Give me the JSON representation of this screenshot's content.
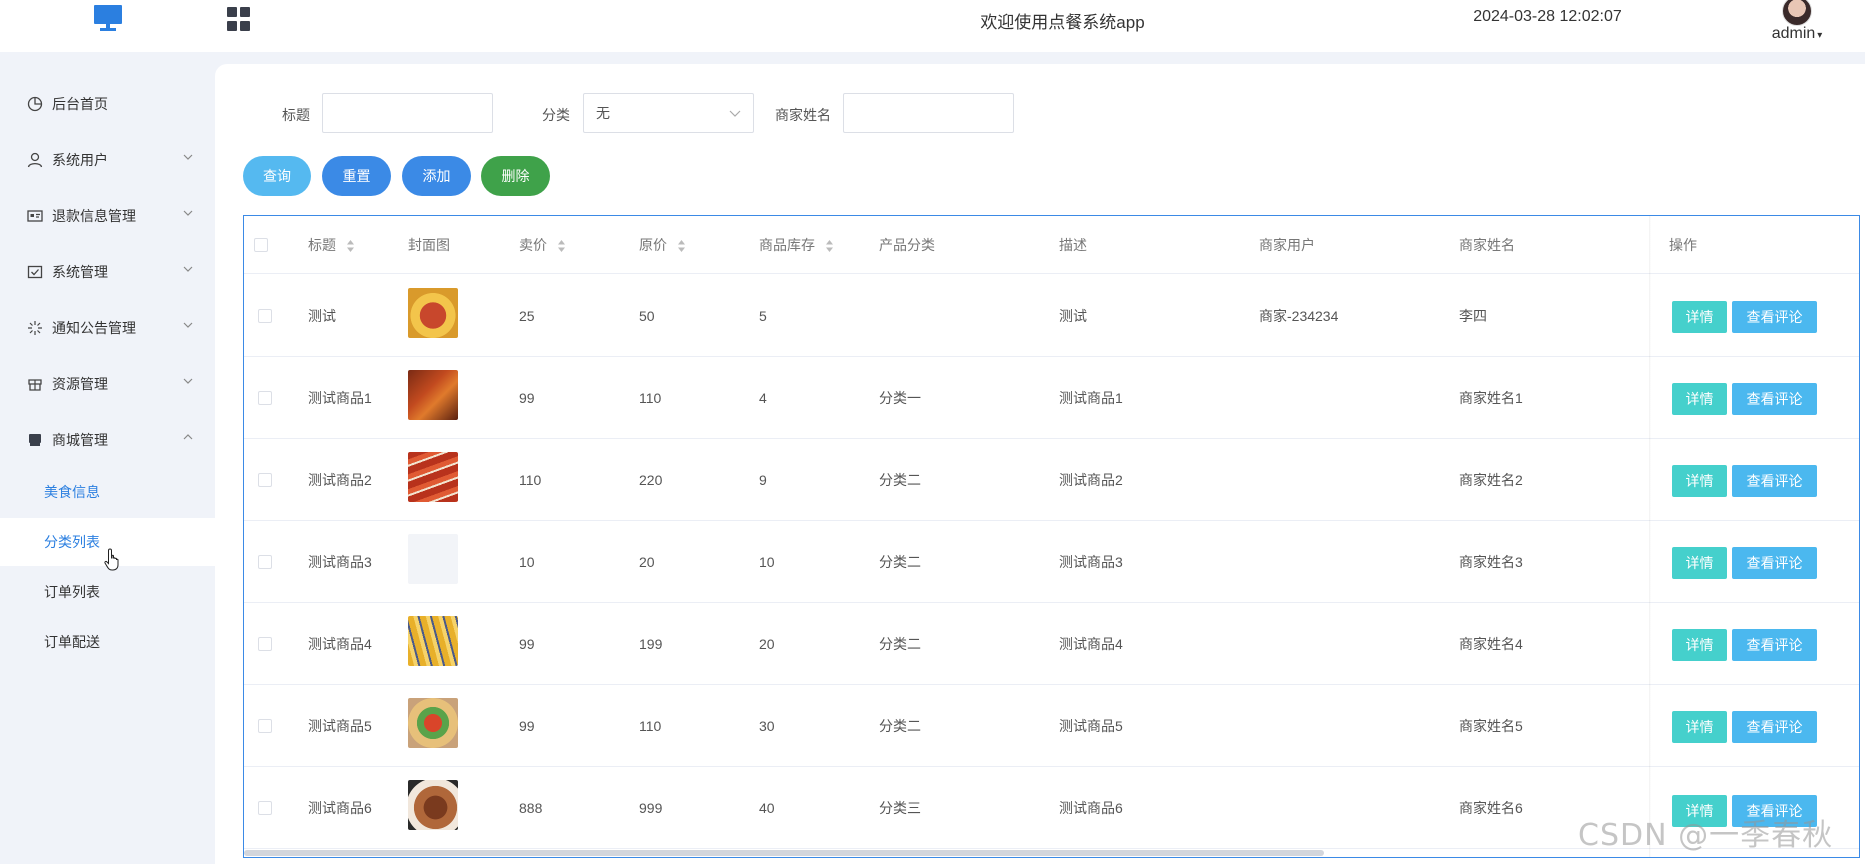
{
  "header": {
    "app_title": "欢迎使用点餐系统app",
    "datetime": "2024-03-28 12:02:07",
    "username": "admin"
  },
  "sidebar": {
    "items": [
      {
        "label": "后台首页",
        "icon": "dashboard-icon",
        "expandable": false
      },
      {
        "label": "系统用户",
        "icon": "user-icon",
        "expandable": true
      },
      {
        "label": "退款信息管理",
        "icon": "id-card-icon",
        "expandable": true
      },
      {
        "label": "系统管理",
        "icon": "checkbox-icon",
        "expandable": true
      },
      {
        "label": "通知公告管理",
        "icon": "sparkle-icon",
        "expandable": true
      },
      {
        "label": "资源管理",
        "icon": "tag-icon",
        "expandable": true
      },
      {
        "label": "商城管理",
        "icon": "shop-icon",
        "expandable": true,
        "expanded": true
      }
    ],
    "submenu": [
      {
        "label": "美食信息",
        "active": false,
        "highlight": true
      },
      {
        "label": "分类列表",
        "active": true
      },
      {
        "label": "订单列表",
        "active": false
      },
      {
        "label": "订单配送",
        "active": false
      }
    ]
  },
  "filters": {
    "title_label": "标题",
    "title_value": "",
    "category_label": "分类",
    "category_value": "无",
    "merchant_label": "商家姓名",
    "merchant_value": ""
  },
  "buttons": {
    "query": "查询",
    "reset": "重置",
    "add": "添加",
    "delete": "删除"
  },
  "table": {
    "headers": {
      "title": "标题",
      "cover": "封面图",
      "price": "卖价",
      "orig_price": "原价",
      "stock": "商品库存",
      "category": "产品分类",
      "desc": "描述",
      "merchant_user": "商家用户",
      "merchant_name": "商家姓名",
      "ops": "操作"
    },
    "op_labels": {
      "detail": "详情",
      "comments": "查看评论"
    },
    "rows": [
      {
        "title": "测试",
        "price": "25",
        "orig_price": "50",
        "stock": "5",
        "category": "",
        "desc": "测试",
        "merchant_user": "商家-234234",
        "merchant_name": "李四",
        "thumb": "noodle-bowl"
      },
      {
        "title": "测试商品1",
        "price": "99",
        "orig_price": "110",
        "stock": "4",
        "category": "分类一",
        "desc": "测试商品1",
        "merchant_user": "",
        "merchant_name": "商家姓名1",
        "thumb": "crayfish"
      },
      {
        "title": "测试商品2",
        "price": "110",
        "orig_price": "220",
        "stock": "9",
        "category": "分类二",
        "desc": "测试商品2",
        "merchant_user": "",
        "merchant_name": "商家姓名2",
        "thumb": "skewers"
      },
      {
        "title": "测试商品3",
        "price": "10",
        "orig_price": "20",
        "stock": "10",
        "category": "分类二",
        "desc": "测试商品3",
        "merchant_user": "",
        "merchant_name": "商家姓名3",
        "thumb": "empty"
      },
      {
        "title": "测试商品4",
        "price": "99",
        "orig_price": "199",
        "stock": "20",
        "category": "分类二",
        "desc": "测试商品4",
        "merchant_user": "",
        "merchant_name": "商家姓名4",
        "thumb": "fries"
      },
      {
        "title": "测试商品5",
        "price": "99",
        "orig_price": "110",
        "stock": "30",
        "category": "分类二",
        "desc": "测试商品5",
        "merchant_user": "",
        "merchant_name": "商家姓名5",
        "thumb": "salad-bowl"
      },
      {
        "title": "测试商品6",
        "price": "888",
        "orig_price": "999",
        "stock": "40",
        "category": "分类三",
        "desc": "测试商品6",
        "merchant_user": "",
        "merchant_name": "商家姓名6",
        "thumb": "meat-dish"
      }
    ]
  },
  "watermark": "CSDN @一季春秋",
  "colors": {
    "accent_blue": "#3b8ae6",
    "query_btn": "#55b9f0",
    "add_btn": "#3b8ae6",
    "delete_btn": "#3fa24a",
    "detail_btn": "#45d0cc",
    "comments_btn": "#4bb8ef",
    "active_menu": "#2b7fe0"
  }
}
